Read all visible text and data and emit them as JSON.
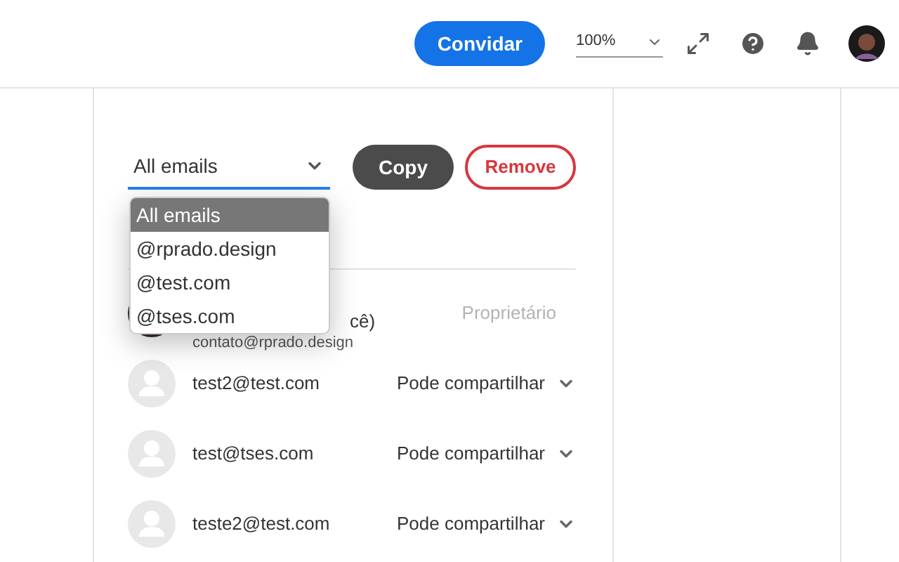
{
  "header": {
    "invite_button": "Convidar",
    "zoom": "100%"
  },
  "filter": {
    "value": "All emails",
    "options": [
      {
        "label": "All emails",
        "selected": true
      },
      {
        "label": "@rprado.design",
        "selected": false
      },
      {
        "label": "@test.com",
        "selected": false
      },
      {
        "label": "@tses.com",
        "selected": false
      }
    ]
  },
  "buttons": {
    "copy": "Copy",
    "remove": "Remove"
  },
  "owner": {
    "name": "cê)",
    "email": "contato@rprado.design",
    "role": "Proprietário"
  },
  "members": [
    {
      "email": "test2@test.com",
      "permission": "Pode compartilhar"
    },
    {
      "email": "test@tses.com",
      "permission": "Pode compartilhar"
    },
    {
      "email": "teste2@test.com",
      "permission": "Pode compartilhar"
    }
  ]
}
